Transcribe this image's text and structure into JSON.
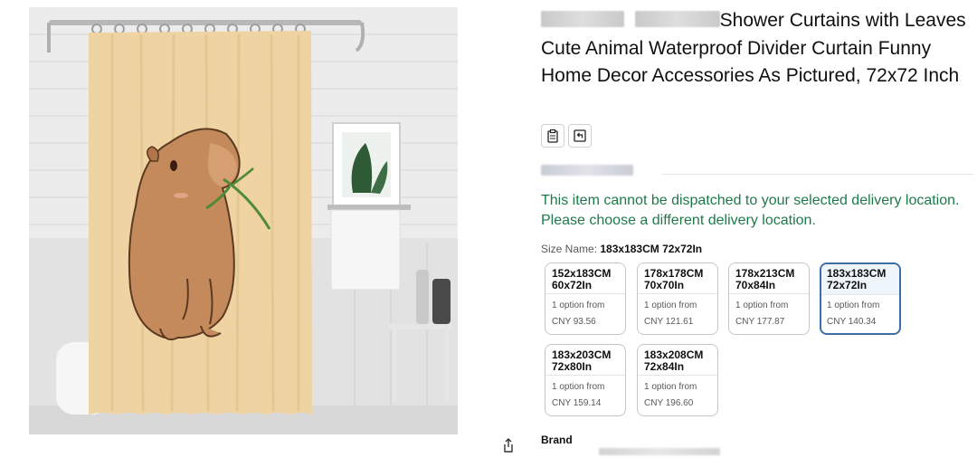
{
  "product": {
    "title_text": "Shower Curtains with Leaves Cute Animal Waterproof Divider Curtain Funny Home Decor Accessories As Pictured, 72x72 Inch"
  },
  "icons": {
    "share": "share-icon",
    "clipboard": "clipboard-icon",
    "return": "return-policy-icon"
  },
  "delivery": {
    "message": "This item cannot be dispatched to your selected delivery location. Please choose a different delivery location."
  },
  "size": {
    "label": "Size Name:",
    "selected": "183x183CM 72x72In",
    "options": [
      {
        "line1": "152x183CM",
        "line2": "60x72In",
        "availability": "1 option from",
        "price": "CNY 93.56"
      },
      {
        "line1": "178x178CM",
        "line2": "70x70In",
        "availability": "1 option from",
        "price": "CNY 121.61"
      },
      {
        "line1": "178x213CM",
        "line2": "70x84In",
        "availability": "1 option from",
        "price": "CNY 177.87"
      },
      {
        "line1": "183x183CM",
        "line2": "72x72In",
        "availability": "1 option from",
        "price": "CNY 140.34",
        "selected": true
      },
      {
        "line1": "183x203CM",
        "line2": "72x80In",
        "availability": "1 option from",
        "price": "CNY 159.14"
      },
      {
        "line1": "183x208CM",
        "line2": "72x84In",
        "availability": "1 option from",
        "price": "CNY 196.60"
      }
    ]
  },
  "brand": {
    "label": "Brand"
  },
  "colors": {
    "curtain": "#efd3a2",
    "capybara": "#c58a5b",
    "delivery_text": "#1f7a4a",
    "selected_border": "#3b6ea5"
  }
}
